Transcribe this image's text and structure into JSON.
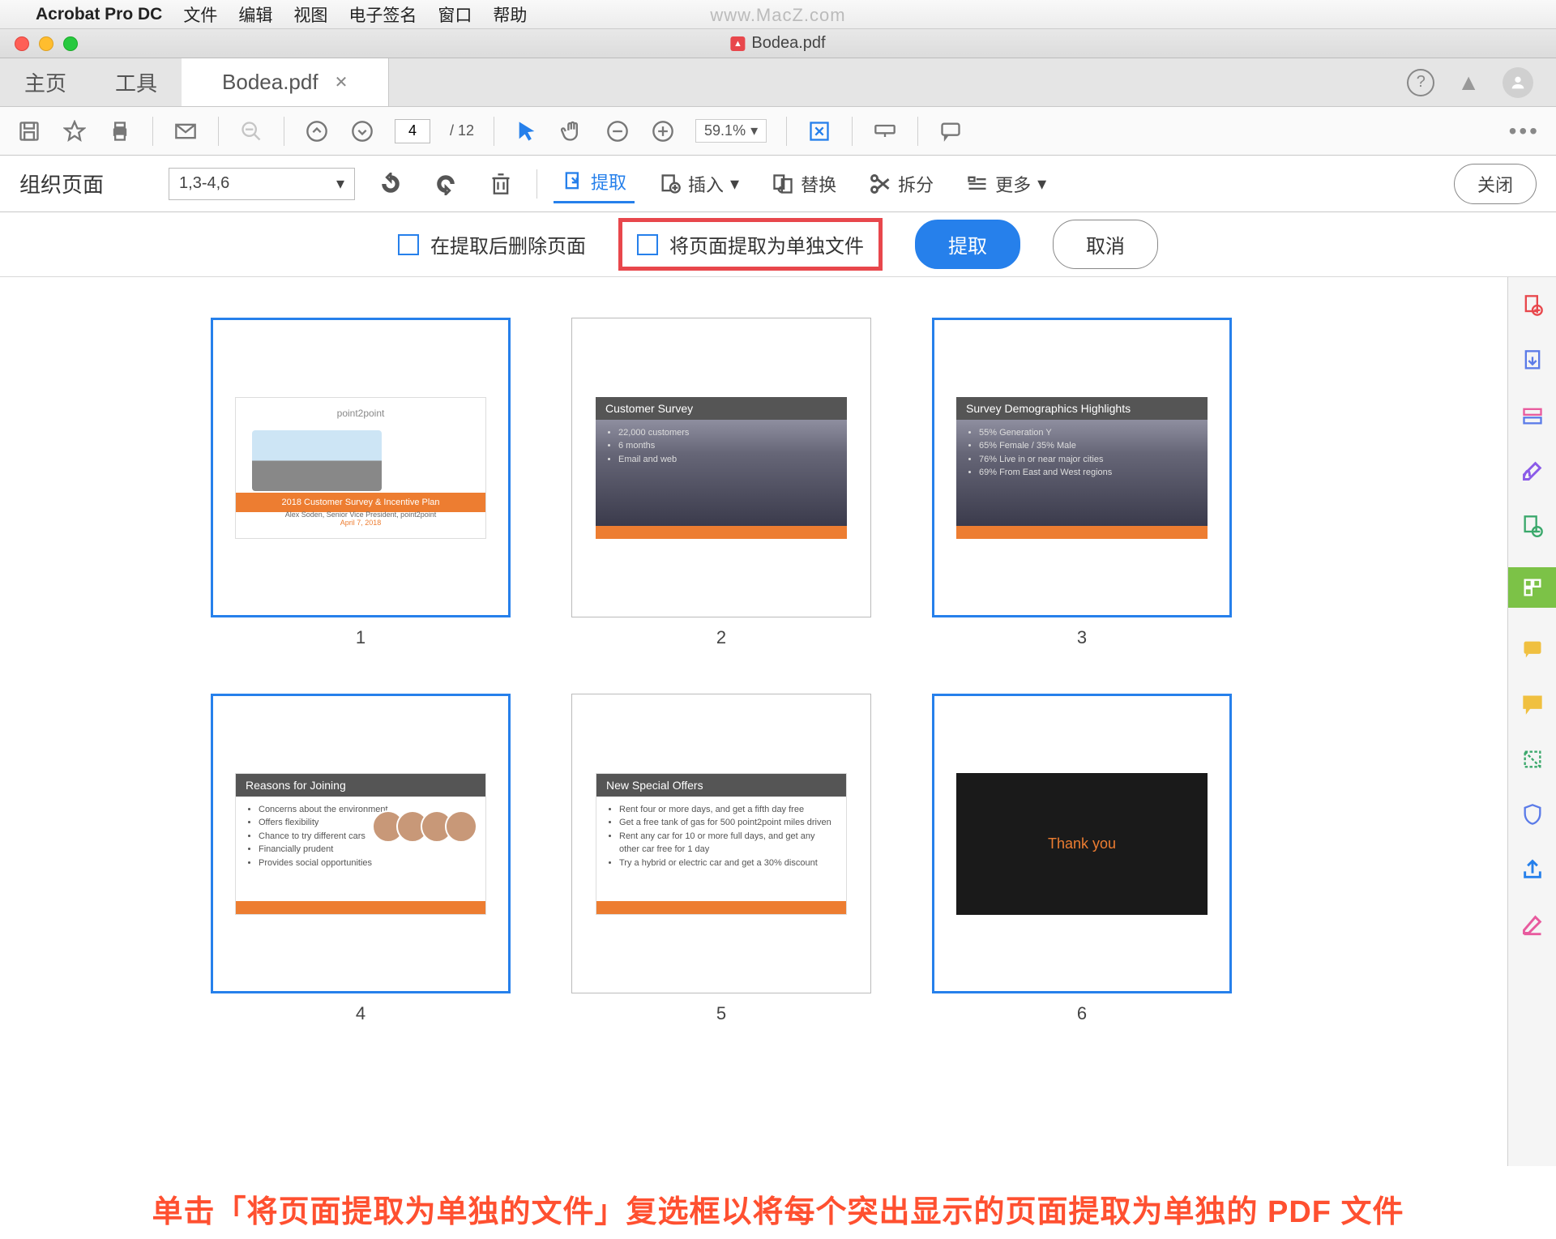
{
  "mac_menu": {
    "app": "Acrobat Pro DC",
    "items": [
      "文件",
      "编辑",
      "视图",
      "电子签名",
      "窗口",
      "帮助"
    ]
  },
  "watermark": "www.MacZ.com",
  "window": {
    "title": "Bodea.pdf"
  },
  "tabs": {
    "home": "主页",
    "tools": "工具",
    "active": "Bodea.pdf"
  },
  "toolbar": {
    "page_current": "4",
    "page_total": "/ 12",
    "zoom": "59.1%"
  },
  "organize": {
    "title": "组织页面",
    "range": "1,3-4,6",
    "extract": "提取",
    "insert": "插入",
    "replace": "替换",
    "split": "拆分",
    "more": "更多",
    "close": "关闭"
  },
  "extract_opts": {
    "delete_after": "在提取后删除页面",
    "separate_files": "将页面提取为单独文件",
    "extract_btn": "提取",
    "cancel_btn": "取消"
  },
  "thumbs": {
    "p1_logo": "point2point",
    "p1_banner": "2018 Customer Survey & Incentive Plan",
    "p1_sub": "Alex Soden, Senior Vice President, point2point",
    "p1_date": "April 7, 2018",
    "p2_title": "Customer Survey",
    "p2_items": [
      "22,000 customers",
      "6 months",
      "Email and web"
    ],
    "p3_title": "Survey Demographics Highlights",
    "p3_items": [
      "55% Generation Y",
      "65% Female / 35% Male",
      "76% Live in or near major cities",
      "69% From East and West regions"
    ],
    "p4_title": "Reasons for Joining",
    "p4_items": [
      "Concerns about the environment",
      "Offers flexibility",
      "Chance to try different cars",
      "Financially prudent",
      "Provides social opportunities"
    ],
    "p5_title": "New Special Offers",
    "p5_items": [
      "Rent four or more days, and get a fifth day free",
      "Get a free tank of gas for 500 point2point miles driven",
      "Rent any car for 10 or more full days, and get any other car free for 1 day",
      "Try a hybrid or electric car and get a 30% discount"
    ],
    "p6_text": "Thank you",
    "nums": [
      "1",
      "2",
      "3",
      "4",
      "5",
      "6"
    ]
  },
  "instruction": "单击「将页面提取为单独的文件」复选框以将每个突出显示的页面提取为单独的 PDF 文件"
}
